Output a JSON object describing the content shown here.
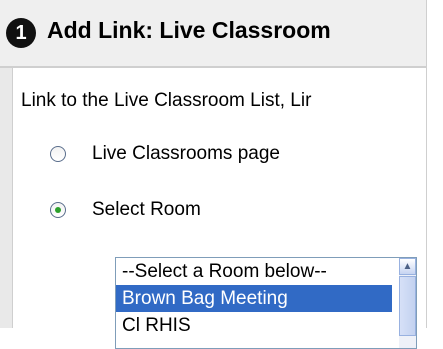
{
  "header": {
    "step_number": "1",
    "title": "Add Link: Live Classroom"
  },
  "intro_text": "Link to the Live Classroom List, Lir",
  "options": [
    {
      "label": "Live Classrooms page",
      "selected": false
    },
    {
      "label": "Select Room",
      "selected": true
    }
  ],
  "room_list": {
    "items": [
      {
        "label": "--Select a Room below--",
        "selected": false
      },
      {
        "label": "Brown Bag Meeting",
        "selected": true
      },
      {
        "label": "Cl       RHIS",
        "selected": false
      }
    ]
  },
  "colors": {
    "header_bg": "#efefef",
    "selection_bg": "#316ac5",
    "radio_checked_dot": "#2ca02c"
  }
}
